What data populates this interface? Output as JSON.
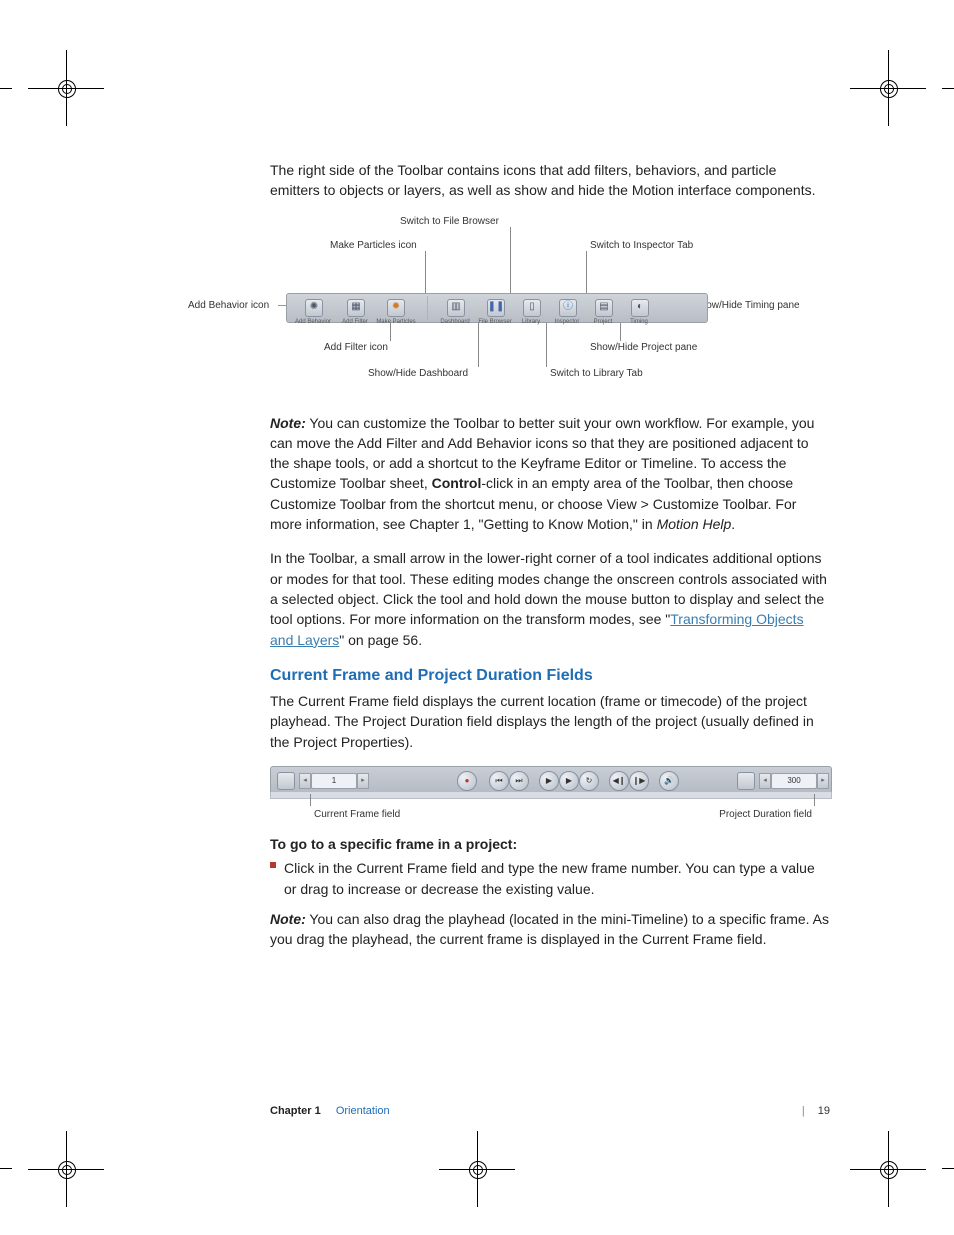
{
  "intro_para": "The right side of the Toolbar contains icons that add filters, behaviors, and particle emitters to objects or layers, as well as show and hide the Motion interface components.",
  "fig1": {
    "items": [
      {
        "label": "Add Behavior",
        "glyph": "✺"
      },
      {
        "label": "Add Filter",
        "glyph": "▦"
      },
      {
        "label": "Make Particles",
        "glyph": "✹"
      },
      {
        "label": "Dashboard",
        "glyph": "▥"
      },
      {
        "label": "File Browser",
        "glyph": "❚❚"
      },
      {
        "label": "Library",
        "glyph": "▯"
      },
      {
        "label": "Inspector",
        "glyph": "ⓘ"
      },
      {
        "label": "Project",
        "glyph": "▤"
      },
      {
        "label": "Timing",
        "glyph": "◐"
      }
    ],
    "callouts": {
      "add_behavior": "Add Behavior icon",
      "add_filter": "Add Filter icon",
      "make_particles": "Make Particles icon",
      "file_browser": "Switch to File Browser",
      "dashboard": "Show/Hide Dashboard",
      "library": "Switch to Library Tab",
      "inspector": "Switch to Inspector Tab",
      "project": "Show/Hide Project pane",
      "timing": "Show/Hide Timing pane"
    }
  },
  "note1_label": "Note:",
  "note1_a": "  You can customize the Toolbar to better suit your own workflow. For example, you can move the Add Filter and Add Behavior icons so that they are positioned adjacent to the shape tools, or add a shortcut to the Keyframe Editor or Timeline. To access the Customize Toolbar sheet, ",
  "note1_bold": "Control",
  "note1_b": "-click in an empty area of the Toolbar, then choose Customize Toolbar from the shortcut menu, or choose View > Customize Toolbar. For more information, see Chapter 1, \"Getting to Know Motion,\" in ",
  "note1_italic": "Motion Help",
  "note1_c": ".",
  "para2_a": "In the Toolbar, a small arrow in the lower-right corner of a tool indicates additional options or modes for that tool. These editing modes change the onscreen controls associated with a selected object. Click the tool and hold down the mouse button to display and select the tool options. For more information on the transform modes, see \"",
  "para2_link": "Transforming Objects and Layers",
  "para2_b": "\" on page 56.",
  "heading": "Current Frame and Project Duration Fields",
  "para3": "The Current Frame field displays the current location (frame or timecode) of the project playhead. The Project Duration field displays the length of the project (usually defined in the Project Properties).",
  "fig2": {
    "current_frame_value": "1",
    "duration_value": "300",
    "caption_left": "Current Frame field",
    "caption_right": "Project Duration field",
    "buttons": [
      "●",
      "⏮",
      "⏭",
      "▶",
      "▶",
      "↻",
      "◀❙",
      "❙▶",
      "🔊"
    ]
  },
  "subhead": "To go to a specific frame in a project:",
  "bullet": "Click in the Current Frame field and type the new frame number. You can type a value or drag to increase or decrease the existing value.",
  "note2_label": "Note:",
  "note2_text": "  You can also drag the playhead (located in the mini-Timeline) to a specific frame. As you drag the playhead, the current frame is displayed in the Current Frame field.",
  "footer": {
    "chapter": "Chapter 1",
    "section": "Orientation",
    "page": "19"
  }
}
